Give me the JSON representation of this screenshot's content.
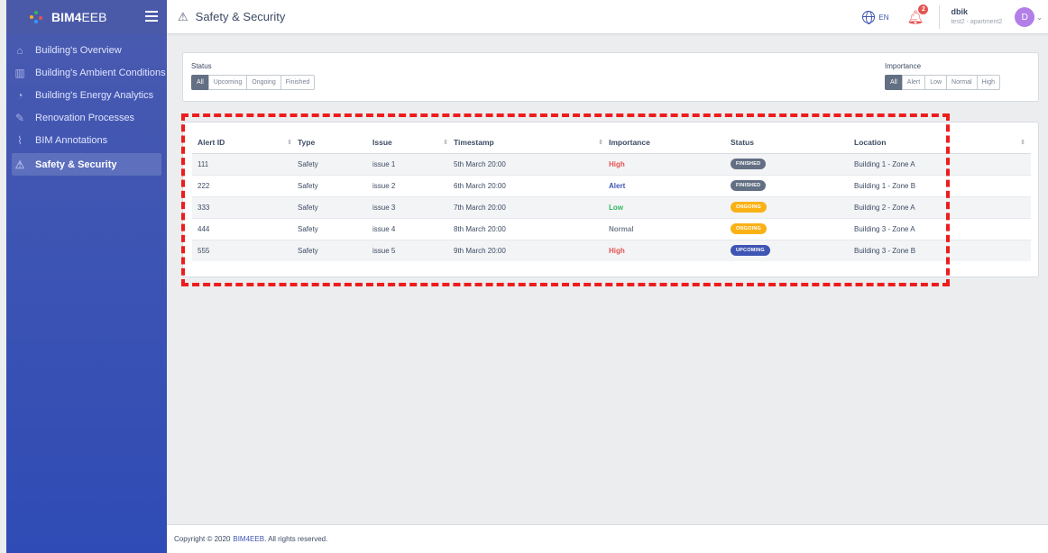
{
  "brand": {
    "name_bold": "BIM4",
    "name_rest": "EEB"
  },
  "sidebar": {
    "items": [
      {
        "label": "Building's Overview",
        "icon": "home-icon"
      },
      {
        "label": "Building's Ambient Conditions",
        "icon": "chart-icon"
      },
      {
        "label": "Building's Energy Analytics",
        "icon": "pie-icon"
      },
      {
        "label": "Renovation Processes",
        "icon": "wrench-icon"
      },
      {
        "label": "BIM Annotations",
        "icon": "paperclip-icon"
      },
      {
        "label": "Safety & Security",
        "icon": "warning-icon"
      }
    ]
  },
  "header": {
    "title": "Safety & Security",
    "lang": "EN",
    "notifications": "2",
    "user": {
      "name": "dbik",
      "context": "test2 - apartment2",
      "initial": "D"
    }
  },
  "filters": {
    "status": {
      "label": "Status",
      "options": [
        "All",
        "Upcoming",
        "Ongoing",
        "Finished"
      ],
      "selected": "All"
    },
    "importance": {
      "label": "Importance",
      "options": [
        "All",
        "Alert",
        "Low",
        "Normal",
        "High"
      ],
      "selected": "All"
    }
  },
  "table": {
    "columns": [
      "Alert ID",
      "Type",
      "Issue",
      "Timestamp",
      "Importance",
      "Status",
      "Location"
    ],
    "rows": [
      {
        "id": "111",
        "type": "Safety",
        "issue": "issue 1",
        "timestamp": "5th March 20:00",
        "importance": "High",
        "status": "FINISHED",
        "location": "Building 1 - Zone A"
      },
      {
        "id": "222",
        "type": "Safety",
        "issue": "issue 2",
        "timestamp": "6th March 20:00",
        "importance": "Alert",
        "status": "FINISHED",
        "location": "Building 1 - Zone B"
      },
      {
        "id": "333",
        "type": "Safety",
        "issue": "issue 3",
        "timestamp": "7th March 20:00",
        "importance": "Low",
        "status": "ONGOING",
        "location": "Building 2 - Zone A"
      },
      {
        "id": "444",
        "type": "Safety",
        "issue": "issue 4",
        "timestamp": "8th March 20:00",
        "importance": "Normal",
        "status": "ONGOING",
        "location": "Building 3 - Zone A"
      },
      {
        "id": "555",
        "type": "Safety",
        "issue": "issue 5",
        "timestamp": "9th March 20:00",
        "importance": "High",
        "status": "UPCOMING",
        "location": "Building 3 - Zone B"
      }
    ]
  },
  "colors": {
    "importance": {
      "High": "#e55353",
      "Alert": "#3e55b3",
      "Low": "#2eb85c",
      "Normal": "#768192"
    },
    "status": {
      "FINISHED": "#636f83",
      "ONGOING": "#f9b115",
      "UPCOMING": "#3e55b3"
    }
  },
  "footer": {
    "prefix": "Copyright © 2020",
    "link": "BIM4EEB",
    "suffix": ". All rights reserved."
  }
}
